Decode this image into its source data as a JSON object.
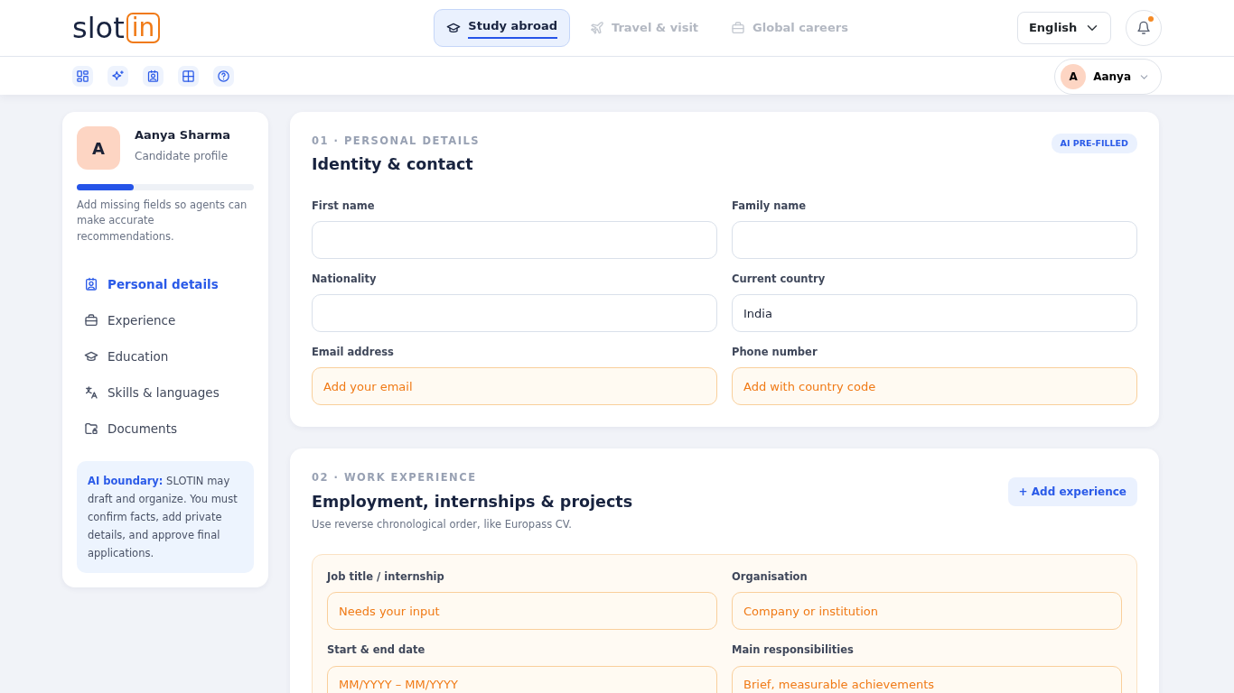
{
  "logo": {
    "text": "slot",
    "boxed": "in"
  },
  "modes": [
    {
      "label": "Study abroad",
      "selected": true
    },
    {
      "label": "Travel & visit",
      "selected": false
    },
    {
      "label": "Global careers",
      "selected": false
    }
  ],
  "language": {
    "value": "English"
  },
  "notifications": {
    "unread": true
  },
  "user": {
    "initial": "A",
    "name": "Aanya"
  },
  "profile": {
    "initial": "A",
    "name": "Aanya Sharma",
    "subtitle": "Candidate profile",
    "level": 0.32,
    "hint": "Add missing fields so agents can make accurate recommendations."
  },
  "sections_nav": [
    {
      "label": "Personal details",
      "selected": true
    },
    {
      "label": "Experience",
      "selected": false
    },
    {
      "label": "Education",
      "selected": false
    },
    {
      "label": "Skills & languages",
      "selected": false
    },
    {
      "label": "Documents",
      "selected": false
    }
  ],
  "notice": "**AI boundary:** SLOTIN may draft and organize. You must confirm facts, add private details, and approve final applications.",
  "personal": {
    "eyebrow": "01 · PERSONAL DETAILS",
    "title": "Identity & contact",
    "badge": "AI PRE-FILLED",
    "fields": [
      {
        "label": "First name",
        "needs_input": false
      },
      {
        "label": "Family name",
        "needs_input": false
      },
      {
        "label": "Nationality",
        "needs_input": false
      },
      {
        "label": "Current country",
        "value": "India",
        "needs_input": false
      },
      {
        "label": "Email address",
        "placeholder": "Add your email",
        "needs_input": true
      },
      {
        "label": "Phone number",
        "placeholder": "Add with country code",
        "needs_input": true
      }
    ]
  },
  "experience": {
    "eyebrow": "02 · WORK EXPERIENCE",
    "title": "Employment, internships & projects",
    "subtitle": "Use reverse chronological order, like Europass CV.",
    "button": "+ Add experience",
    "fields": [
      {
        "label": "Job title / internship",
        "placeholder": "Needs your input",
        "needs_input": true
      },
      {
        "label": "Organisation",
        "placeholder": "Company or institution",
        "needs_input": true
      },
      {
        "label": "Start & end date",
        "placeholder": "MM/YYYY – MM/YYYY",
        "needs_input": true
      },
      {
        "label": "Main responsibilities",
        "placeholder": "Brief, measurable achievements",
        "needs_input": true
      }
    ]
  }
}
